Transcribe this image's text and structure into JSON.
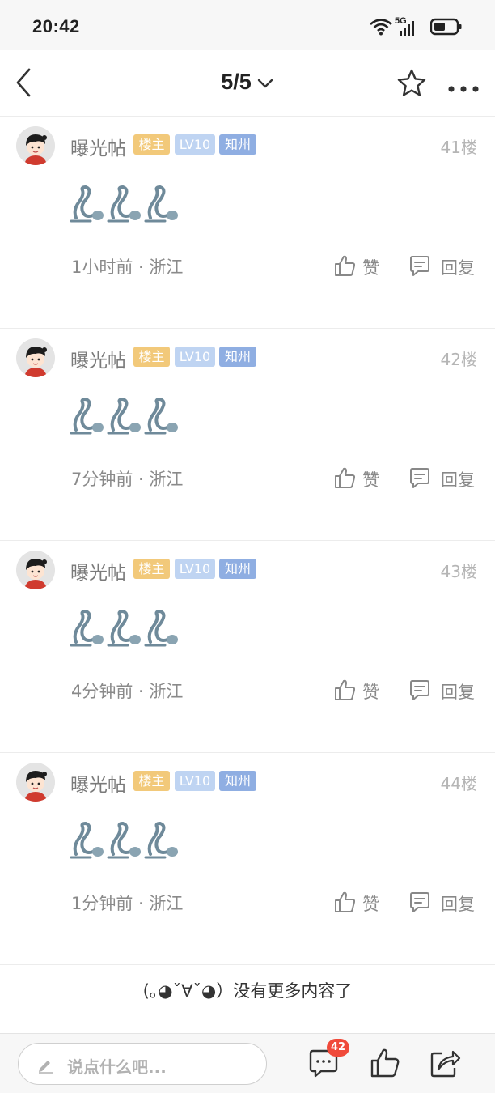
{
  "status_bar": {
    "time": "20:42",
    "network": "5G",
    "icons": [
      "wifi-icon",
      "signal-icon",
      "battery-icon"
    ]
  },
  "nav": {
    "page_indicator": "5/5",
    "icons": [
      "back-arrow-icon",
      "chevron-down-icon",
      "star-icon",
      "more-icon"
    ]
  },
  "posts": [
    {
      "username": "曝光帖",
      "badge_owner": "楼主",
      "badge_level": "LV10",
      "badge_area": "知州",
      "floor": "41楼",
      "time_location": "1小时前 · 浙江",
      "like_label": "赞",
      "reply_label": "回复"
    },
    {
      "username": "曝光帖",
      "badge_owner": "楼主",
      "badge_level": "LV10",
      "badge_area": "知州",
      "floor": "42楼",
      "time_location": "7分钟前 · 浙江",
      "like_label": "赞",
      "reply_label": "回复"
    },
    {
      "username": "曝光帖",
      "badge_owner": "楼主",
      "badge_level": "LV10",
      "badge_area": "知州",
      "floor": "43楼",
      "time_location": "4分钟前 · 浙江",
      "like_label": "赞",
      "reply_label": "回复"
    },
    {
      "username": "曝光帖",
      "badge_owner": "楼主",
      "badge_level": "LV10",
      "badge_area": "知州",
      "floor": "44楼",
      "time_location": "1分钟前 · 浙江",
      "like_label": "赞",
      "reply_label": "回复"
    }
  ],
  "footer_message": "(｡◕ˇ∀ˇ◕）没有更多内容了",
  "bottom_bar": {
    "input_placeholder": "说点什么吧...",
    "comment_count": "42",
    "icons": [
      "edit-pen-icon",
      "comments-icon",
      "thumbs-up-icon",
      "share-icon"
    ]
  },
  "colors": {
    "badge_owner": "#f2c97a",
    "badge_level": "#bfd4f2",
    "badge_area": "#8faee2",
    "comment_badge": "#f04a3a"
  }
}
